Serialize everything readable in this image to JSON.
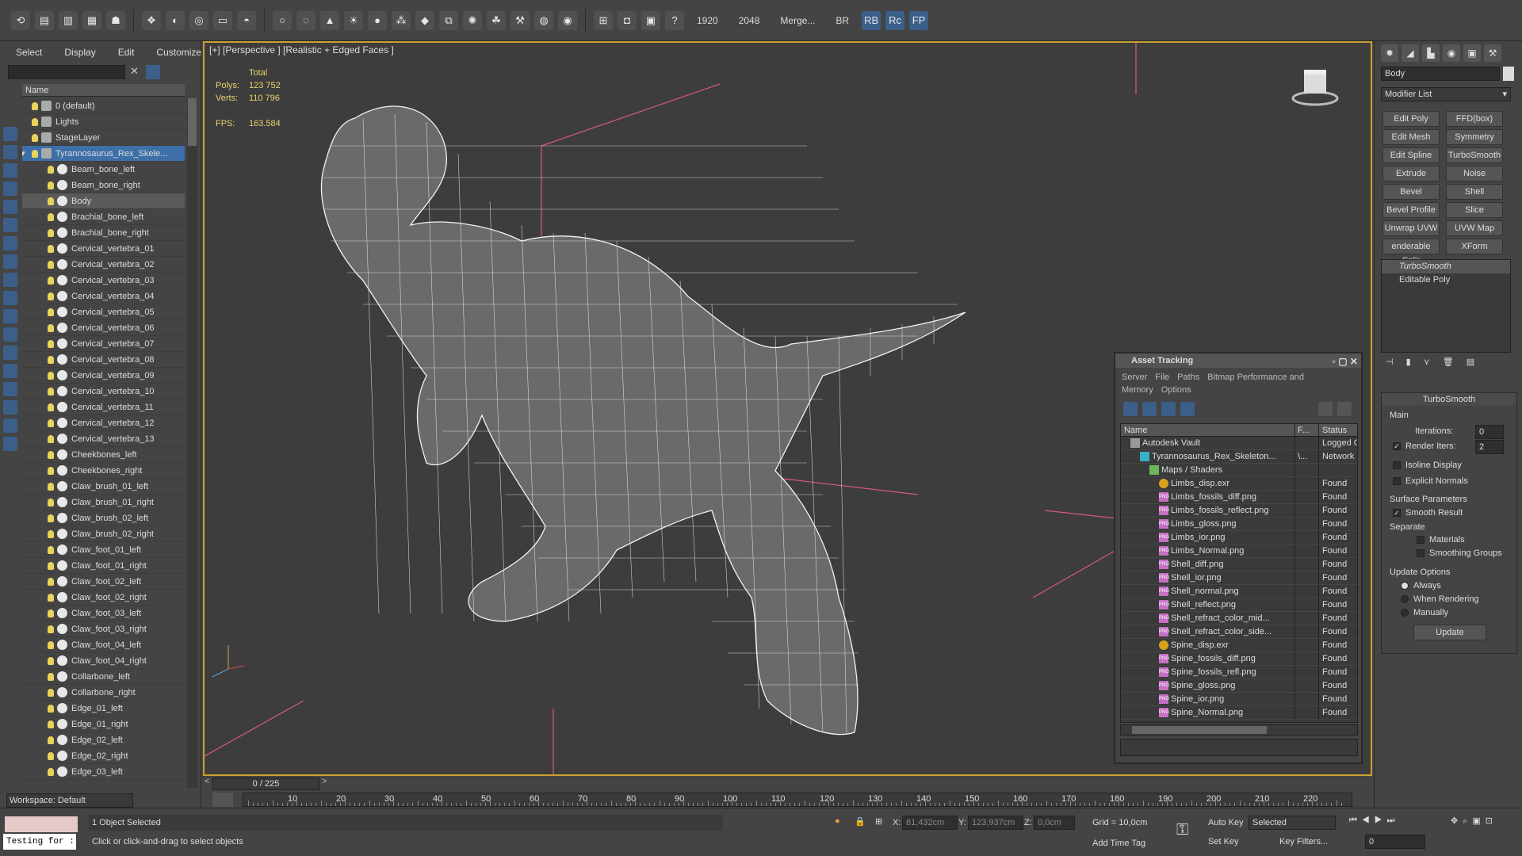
{
  "toolbar": {
    "res1": "1920",
    "res2": "2048",
    "merge": "Merge...",
    "br": "BR",
    "rb": "RB",
    "rc": "Rc",
    "fp": "FP"
  },
  "explorer": {
    "menu": [
      "Select",
      "Display",
      "Edit",
      "Customize"
    ],
    "column": "Name",
    "items": [
      "0 (default)",
      "Lights",
      "StageLayer",
      "Tyrannosaurus_Rex_Skele...",
      "Beam_bone_left",
      "Beam_bone_right",
      "Body",
      "Brachial_bone_left",
      "Brachial_bone_right",
      "Cervical_vertebra_01",
      "Cervical_vertebra_02",
      "Cervical_vertebra_03",
      "Cervical_vertebra_04",
      "Cervical_vertebra_05",
      "Cervical_vertebra_06",
      "Cervical_vertebra_07",
      "Cervical_vertebra_08",
      "Cervical_vertebra_09",
      "Cervical_vertebra_10",
      "Cervical_vertebra_11",
      "Cervical_vertebra_12",
      "Cervical_vertebra_13",
      "Cheekbones_left",
      "Cheekbones_right",
      "Claw_brush_01_left",
      "Claw_brush_01_right",
      "Claw_brush_02_left",
      "Claw_brush_02_right",
      "Claw_foot_01_left",
      "Claw_foot_01_right",
      "Claw_foot_02_left",
      "Claw_foot_02_right",
      "Claw_foot_03_left",
      "Claw_foot_03_right",
      "Claw_foot_04_left",
      "Claw_foot_04_right",
      "Collarbone_left",
      "Collarbone_right",
      "Edge_01_left",
      "Edge_01_right",
      "Edge_02_left",
      "Edge_02_right",
      "Edge_03_left"
    ],
    "workspace": "Workspace: Default"
  },
  "viewport": {
    "label": "[+] [Perspective ] [Realistic + Edged Faces ]",
    "total": "Total",
    "polys_k": "Polys:",
    "polys_v": "123 752",
    "verts_k": "Verts:",
    "verts_v": "110 796",
    "fps_k": "FPS:",
    "fps_v": "163.584"
  },
  "asset": {
    "title": "Asset Tracking",
    "menu": [
      "Server",
      "File",
      "Paths",
      "Bitmap Performance and Memory",
      "Options"
    ],
    "cols": [
      "Name",
      "F...",
      "Status"
    ],
    "rows": [
      {
        "n": "Autodesk Vault",
        "f": "",
        "s": "Logged Ou",
        "t": "vault",
        "d": 1
      },
      {
        "n": "Tyrannosaurus_Rex_Skeleton...",
        "f": "\\...",
        "s": "Network P",
        "t": "max",
        "d": 2
      },
      {
        "n": "Maps / Shaders",
        "f": "",
        "s": "",
        "t": "folder",
        "d": 3
      },
      {
        "n": "Limbs_disp.exr",
        "f": "",
        "s": "Found",
        "t": "exr",
        "d": 4
      },
      {
        "n": "Limbs_fossils_diff.png",
        "f": "",
        "s": "Found",
        "t": "png",
        "d": 4
      },
      {
        "n": "Limbs_fossils_reflect.png",
        "f": "",
        "s": "Found",
        "t": "png",
        "d": 4
      },
      {
        "n": "Limbs_gloss.png",
        "f": "",
        "s": "Found",
        "t": "png",
        "d": 4
      },
      {
        "n": "Limbs_ior.png",
        "f": "",
        "s": "Found",
        "t": "png",
        "d": 4
      },
      {
        "n": "Limbs_Normal.png",
        "f": "",
        "s": "Found",
        "t": "png",
        "d": 4
      },
      {
        "n": "Shell_diff.png",
        "f": "",
        "s": "Found",
        "t": "png",
        "d": 4
      },
      {
        "n": "Shell_ior.png",
        "f": "",
        "s": "Found",
        "t": "png",
        "d": 4
      },
      {
        "n": "Shell_normal.png",
        "f": "",
        "s": "Found",
        "t": "png",
        "d": 4
      },
      {
        "n": "Shell_reflect.png",
        "f": "",
        "s": "Found",
        "t": "png",
        "d": 4
      },
      {
        "n": "Shell_refract_color_mid...",
        "f": "",
        "s": "Found",
        "t": "png",
        "d": 4
      },
      {
        "n": "Shell_refract_color_side...",
        "f": "",
        "s": "Found",
        "t": "png",
        "d": 4
      },
      {
        "n": "Spine_disp.exr",
        "f": "",
        "s": "Found",
        "t": "exr",
        "d": 4
      },
      {
        "n": "Spine_fossils_diff.png",
        "f": "",
        "s": "Found",
        "t": "png",
        "d": 4
      },
      {
        "n": "Spine_fossils_refl.png",
        "f": "",
        "s": "Found",
        "t": "png",
        "d": 4
      },
      {
        "n": "Spine_gloss.png",
        "f": "",
        "s": "Found",
        "t": "png",
        "d": 4
      },
      {
        "n": "Spine_ior.png",
        "f": "",
        "s": "Found",
        "t": "png",
        "d": 4
      },
      {
        "n": "Spine_Normal.png",
        "f": "",
        "s": "Found",
        "t": "png",
        "d": 4
      }
    ]
  },
  "cmd": {
    "object": "Body",
    "modlist": "Modifier List",
    "buttons": [
      "Edit Poly",
      "FFD(box)",
      "Edit Mesh",
      "Symmetry",
      "Edit Spline",
      "TurboSmooth",
      "Extrude",
      "Noise",
      "Bevel",
      "Shell",
      "Bevel Profile",
      "Slice",
      "Unwrap UVW",
      "UVW Map",
      "enderable Splir",
      "XForm"
    ],
    "stack": [
      "TurboSmooth",
      "Editable Poly"
    ],
    "ts": {
      "title": "TurboSmooth",
      "main": "Main",
      "iter": "Iterations:",
      "iter_v": "0",
      "render": "Render Iters:",
      "render_v": "2",
      "isoline": "Isoline Display",
      "explicit": "Explicit Normals",
      "surface": "Surface Parameters",
      "smooth": "Smooth Result",
      "separate": "Separate",
      "materials": "Materials",
      "groups": "Smoothing Groups",
      "update_opts": "Update Options",
      "always": "Always",
      "when": "When Rendering",
      "manually": "Manually",
      "update": "Update"
    }
  },
  "timeline": {
    "frame": "0 / 225",
    "ticks": [
      "10",
      "20",
      "30",
      "40",
      "50",
      "60",
      "70",
      "80",
      "90",
      "100",
      "110",
      "120",
      "130",
      "140",
      "150",
      "160",
      "170",
      "180",
      "190",
      "200",
      "210",
      "220"
    ]
  },
  "status": {
    "maxscript": "Testing for :",
    "selected": "1 Object Selected",
    "hint": "Click or click-and-drag to select objects",
    "x": "X:",
    "xv": "81,432cm",
    "y": "Y:",
    "yv": "123,937cm",
    "z": "Z:",
    "zv": "0,0cm",
    "grid": "Grid = 10,0cm",
    "addtag": "Add Time Tag",
    "autokey": "Auto Key",
    "setkey": "Set Key",
    "selsel": "Selected",
    "filters": "Key Filters...",
    "frame": "0"
  }
}
